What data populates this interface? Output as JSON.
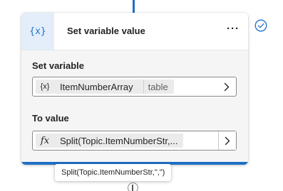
{
  "card": {
    "icon_text": "{x}",
    "title": "Set variable value",
    "more_label": "···"
  },
  "set_variable": {
    "label": "Set variable",
    "icon_text": "{x}",
    "variable_name": "ItemNumberArray",
    "variable_type": "table"
  },
  "to_value": {
    "label": "To value",
    "icon_text": "fx",
    "expression": "Split(Topic.ItemNumberStr,..."
  },
  "tooltip": {
    "text": "Split(Topic.ItemNumberStr,\",\")"
  },
  "icons": {
    "header": "variable-icon",
    "status": "check-circle-icon",
    "chevron": "chevron-right-icon",
    "formula": "formula-fx-icon"
  },
  "colors": {
    "accent": "#1f6fc5",
    "header_icon_bg": "#e3eefa",
    "body_bg": "#f5f5f5"
  }
}
